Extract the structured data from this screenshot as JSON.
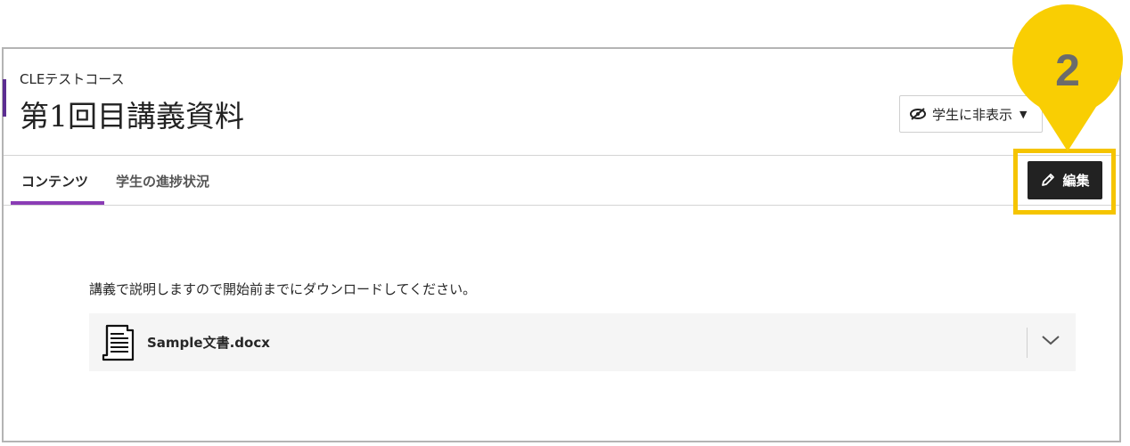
{
  "header": {
    "course_name": "CLEテストコース",
    "page_title": "第1回目講義資料",
    "visibility_label": "学生に非表示",
    "visibility_icon": "eye-slash-icon"
  },
  "tabs": [
    {
      "label": "コンテンツ",
      "active": true
    },
    {
      "label": "学生の進捗状況",
      "active": false
    }
  ],
  "toolbar": {
    "edit_label": "編集",
    "edit_icon": "pencil-icon"
  },
  "callout": {
    "number": "2",
    "color": "#f5c400"
  },
  "content": {
    "description": "講義で説明しますので開始前までにダウンロードしてください。",
    "file": {
      "name": "Sample文書.docx",
      "icon": "document-icon",
      "expand_icon": "chevron-down-icon"
    }
  },
  "colors": {
    "accent": "#8a3cb5",
    "highlight": "#f5c400",
    "edit_button": "#222222"
  }
}
